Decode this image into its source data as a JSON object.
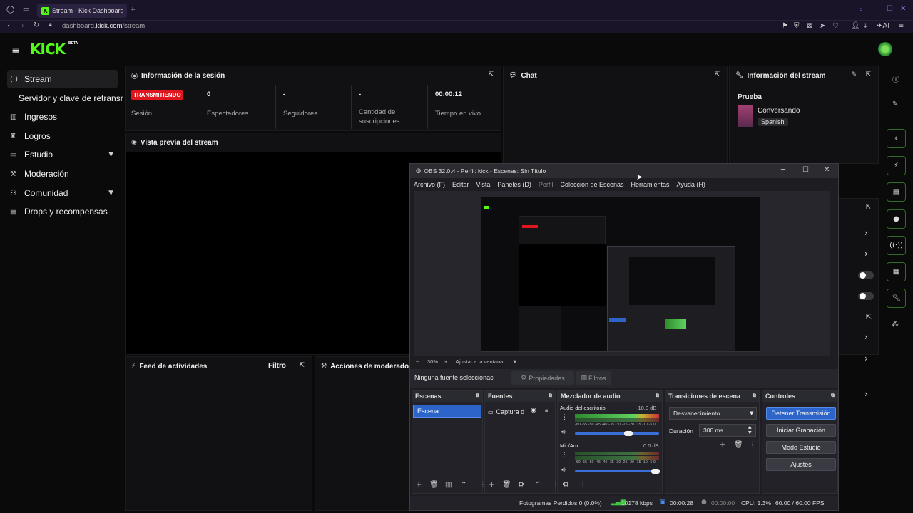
{
  "browser": {
    "tab_title": "Stream - Kick Dashboard",
    "new_tab": "+",
    "url_host": "dashboard.",
    "url_domain": "kick.com",
    "url_path": "/stream",
    "ai_label": "AI"
  },
  "brand": {
    "logo": "KICK",
    "badge": "BETA",
    "accent": "#53fc18"
  },
  "sidebar": {
    "items": [
      {
        "label": "Stream",
        "icon": "broadcast-icon"
      },
      {
        "label": "Servidor y clave de retransmi",
        "icon": ""
      },
      {
        "label": "Ingresos",
        "icon": "chart-icon"
      },
      {
        "label": "Logros",
        "icon": "trophy-icon"
      },
      {
        "label": "Estudio",
        "icon": "studio-icon"
      },
      {
        "label": "Moderación",
        "icon": "hammer-icon"
      },
      {
        "label": "Comunidad",
        "icon": "people-icon"
      },
      {
        "label": "Drops y recompensas",
        "icon": "gift-icon"
      }
    ]
  },
  "session": {
    "title": "Información de la sesión",
    "status_badge": "TRANSMITIENDO",
    "stats": [
      {
        "label": "Sesión",
        "value": ""
      },
      {
        "label": "Espectadores",
        "value": "0"
      },
      {
        "label": "Seguidores",
        "value": "-"
      },
      {
        "label": "Cantidad de suscripciones",
        "value": "-"
      },
      {
        "label": "Tiempo en vivo",
        "value": "00:00:12"
      }
    ]
  },
  "chat": {
    "title": "Chat"
  },
  "stream_info": {
    "title": "Información del stream",
    "stream_title": "Prueba",
    "category": "Conversando",
    "language": "Spanish"
  },
  "preview": {
    "title": "Vista previa del stream"
  },
  "activity": {
    "title": "Feed de actividades",
    "filter": "Filtro"
  },
  "modactions": {
    "title": "Acciones de moderador"
  },
  "obs": {
    "window_title": "OBS 32.0.4 - Perfil: kick - Escenas: Sin Título",
    "menu": [
      "Archivo (F)",
      "Editar",
      "Vista",
      "Paneles (D)",
      "Perfil",
      "Colección de Escenas",
      "Herramientas",
      "Ayuda (H)"
    ],
    "zoom_minus": "−",
    "zoom": "30%",
    "zoom_plus": "+",
    "fit": "Ajustar a la ventana",
    "no_source": "Ninguna fuente seleccionac",
    "properties": "Propiedades",
    "filters": "Filtros",
    "scenes_title": "Escenas",
    "scene_selected": "Escena",
    "sources_title": "Fuentes",
    "source_item": "Captura d",
    "mixer_title": "Mezclador de audio",
    "mixer": [
      {
        "name": "Audio del escritorio",
        "db": "-10.0 dB",
        "level": 0.62
      },
      {
        "name": "Mic/Aux",
        "db": "0.0 dB",
        "level": 1.0
      }
    ],
    "mixer_scale": "-60 -55 -50 -45 -40 -35 -30 -25 -20 -15 -10 -5 0",
    "transitions_title": "Transiciones de escena",
    "transition": "Desvanecimiento",
    "duration_label": "Duración",
    "duration": "300 ms",
    "controls_title": "Controles",
    "controls": [
      "Detener Transmisión",
      "Iniciar Grabación",
      "Modo Estudio",
      "Ajustes"
    ],
    "status": {
      "dropped": "Fotogramas Perdidos 0 (0.0%)",
      "kbps": "10178 kbps",
      "stream_time": "00:00:28",
      "rec_time": "00:00:00",
      "cpu": "CPU: 1.3%",
      "fps": "60.00 / 60.00 FPS"
    }
  }
}
